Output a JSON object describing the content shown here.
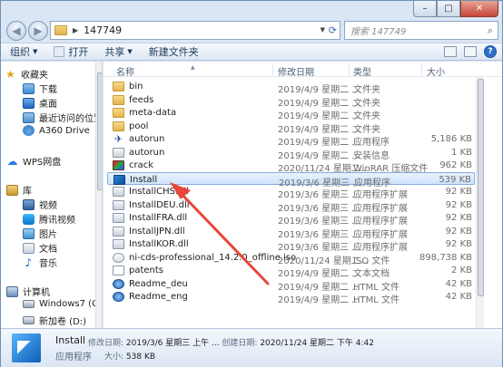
{
  "address": {
    "path": "147749",
    "search_placeholder": "搜索 147749"
  },
  "toolbar": {
    "organize": "组织",
    "open": "打开",
    "share": "共享",
    "new_folder": "新建文件夹"
  },
  "window_buttons": {
    "minimize": "–",
    "maximize": "□",
    "close": "✕"
  },
  "nav": {
    "favorites": "收藏夹",
    "downloads": "下载",
    "desktop": "桌面",
    "recent": "最近访问的位置",
    "a360": "A360 Drive",
    "wps": "WPS网盘",
    "library": "库",
    "videos": "视频",
    "tencent_video": "腾讯视频",
    "pictures": "图片",
    "documents": "文档",
    "music": "音乐",
    "computer": "计算机",
    "drive_c": "Windows7 (C:)",
    "drive_d": "新加卷 (D:)"
  },
  "columns": {
    "name": "名称",
    "date": "修改日期",
    "type": "类型",
    "size": "大小"
  },
  "files": [
    {
      "name": "bin",
      "date": "2019/4/9 星期二 ...",
      "type": "文件夹",
      "size": "",
      "icon": "folder"
    },
    {
      "name": "feeds",
      "date": "2019/4/9 星期二 ...",
      "type": "文件夹",
      "size": "",
      "icon": "folder"
    },
    {
      "name": "meta-data",
      "date": "2019/4/9 星期二 ...",
      "type": "文件夹",
      "size": "",
      "icon": "folder"
    },
    {
      "name": "pool",
      "date": "2019/4/9 星期二 ...",
      "type": "文件夹",
      "size": "",
      "icon": "folder"
    },
    {
      "name": "autorun",
      "date": "2019/4/9 星期二 ...",
      "type": "应用程序",
      "size": "5,186 KB",
      "icon": "exe-blue"
    },
    {
      "name": "autorun",
      "date": "2019/4/9 星期二 ...",
      "type": "安装信息",
      "size": "1 KB",
      "icon": "inf"
    },
    {
      "name": "crack",
      "date": "2020/11/24 星期二...",
      "type": "WinRAR 压缩文件",
      "size": "962 KB",
      "icon": "rar"
    },
    {
      "name": "Install",
      "date": "2019/3/6 星期三 ...",
      "type": "应用程序",
      "size": "539 KB",
      "icon": "install",
      "selected": true
    },
    {
      "name": "InstallCHS.dll",
      "date": "2019/3/6 星期三 ...",
      "type": "应用程序扩展",
      "size": "92 KB",
      "icon": "dll"
    },
    {
      "name": "InstallDEU.dll",
      "date": "2019/3/6 星期三 ...",
      "type": "应用程序扩展",
      "size": "92 KB",
      "icon": "dll"
    },
    {
      "name": "InstallFRA.dll",
      "date": "2019/3/6 星期三 ...",
      "type": "应用程序扩展",
      "size": "92 KB",
      "icon": "dll"
    },
    {
      "name": "InstallJPN.dll",
      "date": "2019/3/6 星期三 ...",
      "type": "应用程序扩展",
      "size": "92 KB",
      "icon": "dll"
    },
    {
      "name": "InstallKOR.dll",
      "date": "2019/3/6 星期三 ...",
      "type": "应用程序扩展",
      "size": "92 KB",
      "icon": "dll"
    },
    {
      "name": "ni-cds-professional_14.2.0_offline.iso",
      "date": "2020/11/24 星期二...",
      "type": "ISO 文件",
      "size": "898,738 KB",
      "icon": "iso"
    },
    {
      "name": "patents",
      "date": "2019/4/9 星期二 ...",
      "type": "文本文档",
      "size": "2 KB",
      "icon": "txt"
    },
    {
      "name": "Readme_deu",
      "date": "2019/4/9 星期二 ...",
      "type": "HTML 文件",
      "size": "42 KB",
      "icon": "html"
    },
    {
      "name": "Readme_eng",
      "date": "2019/4/9 星期二 ...",
      "type": "HTML 文件",
      "size": "42 KB",
      "icon": "html"
    }
  ],
  "details": {
    "name": "Install",
    "type": "应用程序",
    "modified_label": "修改日期:",
    "modified": "2019/3/6 星期三 上午 ...",
    "created_label": "创建日期:",
    "created": "2020/11/24 星期二 下午 4:42",
    "size_label": "大小:",
    "size": "538 KB"
  },
  "colors": {
    "selection": "#cfe3fb",
    "annotation_arrow": "#e8463a"
  }
}
